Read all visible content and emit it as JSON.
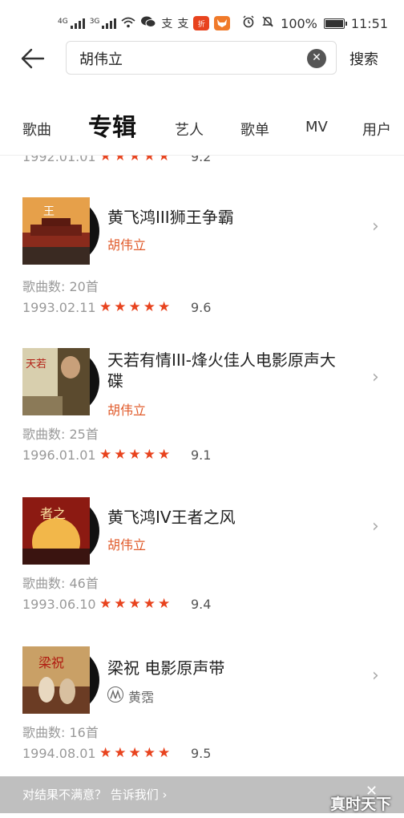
{
  "status_bar": {
    "signal1_label": "4G",
    "signal2_label": "3G",
    "badge_text": "折",
    "battery": "100%",
    "time": "11:51"
  },
  "search": {
    "query": "胡伟立",
    "search_label": "搜索"
  },
  "tabs": [
    {
      "label": "歌曲",
      "active": false
    },
    {
      "label": "专辑",
      "active": true
    },
    {
      "label": "艺人",
      "active": false
    },
    {
      "label": "歌单",
      "active": false
    },
    {
      "label": "MV",
      "active": false
    },
    {
      "label": "用户",
      "active": false
    }
  ],
  "partial_album": {
    "date": "1992.01.01",
    "stars": "★★★★★",
    "rating": "9.2"
  },
  "albums": [
    {
      "title": "黄飞鸿III狮王争霸",
      "artist": "胡伟立",
      "count": "歌曲数: 20首",
      "date": "1993.02.11",
      "stars": "★★★★★",
      "rating": "9.6",
      "cover_colors": [
        "#e6a04a",
        "#8a2b1c"
      ]
    },
    {
      "title": "天若有情III-烽火佳人电影原声大碟",
      "artist": "胡伟立",
      "count": "歌曲数: 25首",
      "date": "1996.01.01",
      "stars": "★★★★★",
      "rating": "9.1",
      "cover_colors": [
        "#d8cfae",
        "#5b4a2e"
      ]
    },
    {
      "title": "黄飞鸿IV王者之风",
      "artist": "胡伟立",
      "count": "歌曲数: 46首",
      "date": "1993.06.10",
      "stars": "★★★★★",
      "rating": "9.4",
      "cover_colors": [
        "#f2b74a",
        "#8c1a12"
      ]
    },
    {
      "title": "梁祝 电影原声带",
      "artist": "黄霑",
      "count": "歌曲数: 16首",
      "date": "1994.08.01",
      "stars": "★★★★★",
      "rating": "9.5",
      "cover_colors": [
        "#c9a066",
        "#6b3c24"
      ]
    }
  ],
  "feedback": {
    "text": "对结果不满意？ 告诉我们 ›",
    "close": "✕"
  },
  "watermark": "真时天下",
  "colors": {
    "accent": "#e05a2a",
    "star": "#e8431e"
  }
}
